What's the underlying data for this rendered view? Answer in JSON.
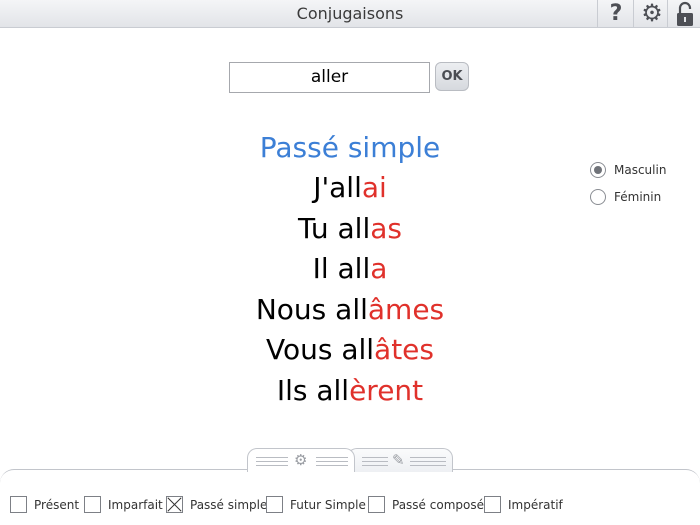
{
  "window": {
    "title": "Conjugaisons"
  },
  "toolbar": {
    "help_icon": "help-icon",
    "settings_icon": "gear-icon",
    "lock_icon": "lock-icon"
  },
  "search": {
    "value": "aller",
    "button_label": "OK"
  },
  "conjugation": {
    "tense": "Passé simple",
    "lines": [
      {
        "stem": "J'all",
        "ending": "ai"
      },
      {
        "stem": "Tu all",
        "ending": "as"
      },
      {
        "stem": "Il all",
        "ending": "a"
      },
      {
        "stem": "Nous all",
        "ending": "âmes"
      },
      {
        "stem": "Vous all",
        "ending": "âtes"
      },
      {
        "stem": "Ils all",
        "ending": "èrent"
      }
    ]
  },
  "gender": {
    "options": [
      "Masculin",
      "Féminin"
    ],
    "selected": "Masculin"
  },
  "tenses": {
    "options": [
      "Présent",
      "Imparfait",
      "Passé simple",
      "Futur Simple",
      "Passé composé",
      "Impératif"
    ],
    "checked": [
      "Passé simple"
    ]
  },
  "colors": {
    "tense_title": "#3c7fd6",
    "ending": "#e0312b"
  }
}
